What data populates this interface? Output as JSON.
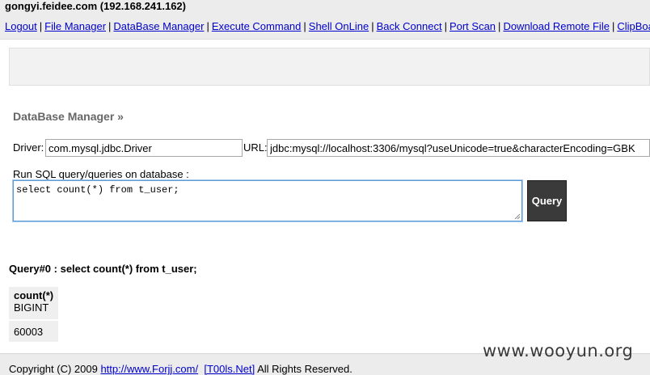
{
  "header": {
    "host_title": "gongyi.feidee.com (192.168.241.162)",
    "nav": [
      {
        "label": "Logout"
      },
      {
        "label": "File Manager"
      },
      {
        "label": "DataBase Manager"
      },
      {
        "label": "Execute Command"
      },
      {
        "label": "Shell OnLine"
      },
      {
        "label": "Back Connect"
      },
      {
        "label": "Port Scan"
      },
      {
        "label": "Download Remote File"
      },
      {
        "label": "ClipBoard"
      }
    ],
    "separator": "|"
  },
  "db_manager": {
    "title": "DataBase Manager »",
    "driver_label": "Driver:",
    "driver_value": "com.mysql.jdbc.Driver",
    "url_label": "URL:",
    "url_value": "jdbc:mysql://localhost:3306/mysql?useUnicode=true&characterEncoding=GBK",
    "sql_label": "Run SQL query/queries on database :",
    "sql_value": "select count(*) from t_user;",
    "query_button": "Query"
  },
  "result": {
    "heading": "Query#0 : select count(*) from t_user;",
    "columns": [
      {
        "name": "count(*)",
        "type": "BIGINT"
      }
    ],
    "rows": [
      [
        "60003"
      ]
    ]
  },
  "footer": {
    "copyright": "Copyright (C) 2009 ",
    "link1": "http://www.Forjj.com/",
    "link2": "[T00ls.Net]",
    "rights": " All Rights Reserved."
  },
  "watermark": "www.wooyun.org"
}
